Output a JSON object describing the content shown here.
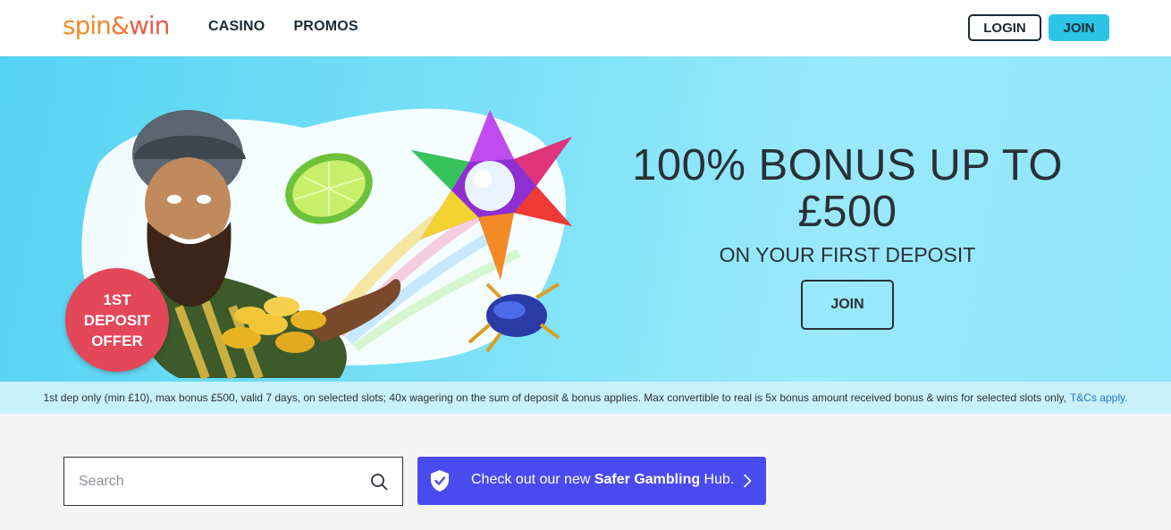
{
  "brand": {
    "logo_part1": "spin",
    "logo_amp": "&",
    "logo_part2": "win",
    "colors": {
      "orange": "#f08a2b",
      "coral": "#e65f4a",
      "accent_cyan": "#2cc4e8",
      "safer_blue": "#4a4bef",
      "badge_red": "#e4465a"
    }
  },
  "nav": {
    "items": [
      {
        "label": "CASINO"
      },
      {
        "label": "PROMOS"
      }
    ],
    "login_label": "LOGIN",
    "join_label": "JOIN"
  },
  "hero": {
    "badge_line1": "1ST",
    "badge_line2": "DEPOSIT",
    "badge_line3": "OFFER",
    "title_line1": "100% BONUS UP TO",
    "title_line2": "£500",
    "subtitle": "ON YOUR FIRST DEPOSIT",
    "join_label": "JOIN"
  },
  "terms": {
    "text": "1st dep only (min £10), max bonus £500, valid 7 days, on selected slots; 40x wagering on the sum of deposit & bonus applies. Max convertible to real is 5x bonus amount received bonus & wins for selected slots only,",
    "link": "T&Cs apply."
  },
  "search": {
    "placeholder": "Search",
    "icon": "search-icon"
  },
  "safer_gambling": {
    "prefix": "Check out our new ",
    "bold": "Safer Gambling",
    "suffix": " Hub.",
    "icon": "shield-check-icon"
  }
}
